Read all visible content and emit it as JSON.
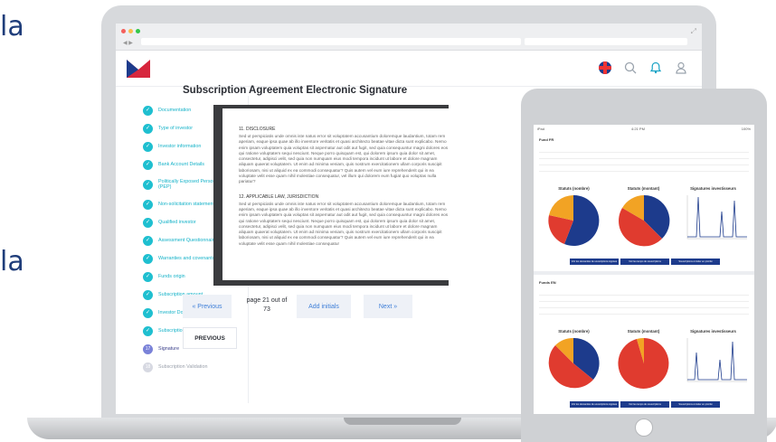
{
  "side_text": [
    "la",
    "la"
  ],
  "header": {
    "logo": "envelope-m-logo",
    "icons": [
      "uk-flag-icon",
      "search-icon",
      "bell-icon",
      "user-icon"
    ],
    "colors": {
      "brand_red": "#d7263d",
      "brand_navy": "#1d3b8c",
      "accent_teal": "#1fbfd0"
    }
  },
  "steps": [
    {
      "label": "Documentation",
      "state": "done"
    },
    {
      "label": "Type of investor",
      "state": "done"
    },
    {
      "label": "Investor information",
      "state": "done"
    },
    {
      "label": "Bank Account Details",
      "state": "done"
    },
    {
      "label": "Politically Exposed Person",
      "label2": "(PEP)",
      "state": "done"
    },
    {
      "label": "Non-solicitation statement",
      "state": "done"
    },
    {
      "label": "Qualified investor",
      "state": "done"
    },
    {
      "label": "Assessment Questionnaire",
      "state": "done"
    },
    {
      "label": "Warranties and covenants",
      "state": "done"
    },
    {
      "label": "Funds origin",
      "state": "done"
    },
    {
      "label": "Subscription amount",
      "state": "done"
    },
    {
      "label": "Investor Documents",
      "state": "done"
    },
    {
      "label": "Subscription summary",
      "state": "done"
    },
    {
      "label": "Signature",
      "state": "current",
      "number": "17"
    },
    {
      "label": "Subscription Validation",
      "state": "pending",
      "number": "18"
    }
  ],
  "document": {
    "title": "Subscription Agreement Electronic Signature",
    "sections": [
      {
        "heading": "11. DISCLOSURE",
        "text": "Sed ut perspiciatis unde omnis iste natus error sit voluptatem accusantium doloremque laudantium, totam rem aperiam, eaque ipsa quae ab illo inventore veritatis et quasi architecto beatae vitae dicta sunt explicabo. Nemo enim ipsam voluptatem quia voluptas sit aspernatur aut odit aut fugit, sed quia consequuntur magni dolores eos qui ratione voluptatem sequi nesciunt. Neque porro quisquam est, qui dolorem ipsum quia dolor sit amet, consectetur, adipisci velit, sed quia non numquam eius modi tempora incidunt ut labore et dolore magnam aliquam quaerat voluptatem. Ut enim ad minima veniam, quis nostrum exercitationem ullam corporis suscipit laboriosam, nisi ut aliquid ex ea commodi consequatur? Quis autem vel eum iure reprehenderit qui in ea voluptate velit esse quam nihil molestiae consequatur, vel illum qui dolorem eum fugiat quo voluptas nulla pariatur?"
      },
      {
        "heading": "12. APPLICABLE LAW, JURISDICTION",
        "text": "Sed ut perspiciatis unde omnis iste natus error sit voluptatem accusantium doloremque laudantium, totam rem aperiam, eaque ipsa quae ab illo inventore veritatis et quasi architecto beatae vitae dicta sunt explicabo. Nemo enim ipsam voluptatem quia voluptas sit aspernatur aut odit aut fugit, sed quia consequuntur magni dolores eos qui ratione voluptatem sequi nesciunt. Neque porro quisquam est, qui dolorem ipsum quia dolor sit amet, consectetur, adipisci velit, sed quia non numquam eius modi tempora incidunt ut labore et dolore magnam aliquam quaerat voluptatem. Ut enim ad minima veniam, quis nostrum exercitationem ullam corporis suscipit laboriosam, nisi ut aliquid ex ea commodi consequatur? Quis autem vel eum iure reprehenderit qui in ea voluptate velit esse quam nihil molestiae consequatur"
      }
    ]
  },
  "pager": {
    "prev_label": "« Previous",
    "page_info_line1": "page 21 out of",
    "page_info_line2": "73",
    "initials_label": "Add initials",
    "next_label": "Next »",
    "previous_label": "PREVIOUS"
  },
  "tablet": {
    "status_left": "iPad",
    "status_time": "4:21 PM",
    "status_right": "100%",
    "funds": [
      {
        "name": "Fund FR",
        "chart_titles": [
          "Statuts (nombre)",
          "Statuts (montant)",
          "Signatures investisseurs"
        ],
        "buttons": [
          "Voir les demandes de souscriptions signées",
          "Voir les temps de souscriptions",
          "Souscriptions à traiter en priorité"
        ]
      },
      {
        "name": "Funds EN",
        "chart_titles": [
          "Statuts (nombre)",
          "Statuts (montant)",
          "Signatures investisseurs"
        ],
        "buttons": [
          "Voir les demandes de souscriptions signées",
          "Voir les temps de souscriptions",
          "Souscriptions à traiter en priorité"
        ]
      }
    ]
  }
}
